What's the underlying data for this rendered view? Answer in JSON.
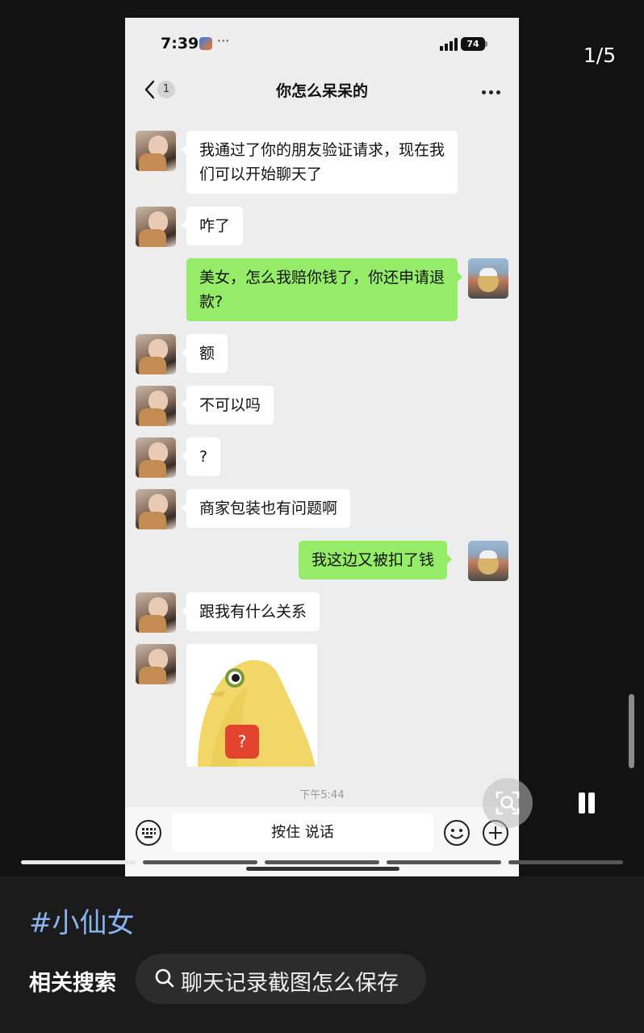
{
  "viewer": {
    "page_counter": "1/5",
    "progress": {
      "current": 1,
      "total": 5
    }
  },
  "status_bar": {
    "time": "7:39",
    "dots": "···",
    "battery": "74"
  },
  "chat": {
    "back_badge": "1",
    "title": "你怎么呆呆的",
    "messages": [
      {
        "side": "in",
        "text": "我通过了你的朋友验证请求，现在我们可以开始聊天了"
      },
      {
        "side": "in",
        "text": "咋了"
      },
      {
        "side": "out",
        "text": "美女，怎么我赔你钱了，你还申请退款?"
      },
      {
        "side": "in",
        "text": "额"
      },
      {
        "side": "in",
        "text": "不可以吗"
      },
      {
        "side": "in",
        "text": "?"
      },
      {
        "side": "in",
        "text": "商家包装也有问题啊"
      },
      {
        "side": "out",
        "text": "我这边又被扣了钱"
      },
      {
        "side": "in",
        "text": "跟我有什么关系"
      }
    ],
    "sticker_badge": "?",
    "timestamp": "下午5:44",
    "input": {
      "voice_label": "按住 说话"
    }
  },
  "footer": {
    "hashtag": "#小仙女",
    "related_label": "相关搜索",
    "search_chip": "聊天记录截图怎么保存"
  },
  "colors": {
    "bubble_out": "#95ec69",
    "bubble_in": "#ffffff",
    "chat_bg": "#ededed",
    "hashtag": "#8ab4f0"
  }
}
